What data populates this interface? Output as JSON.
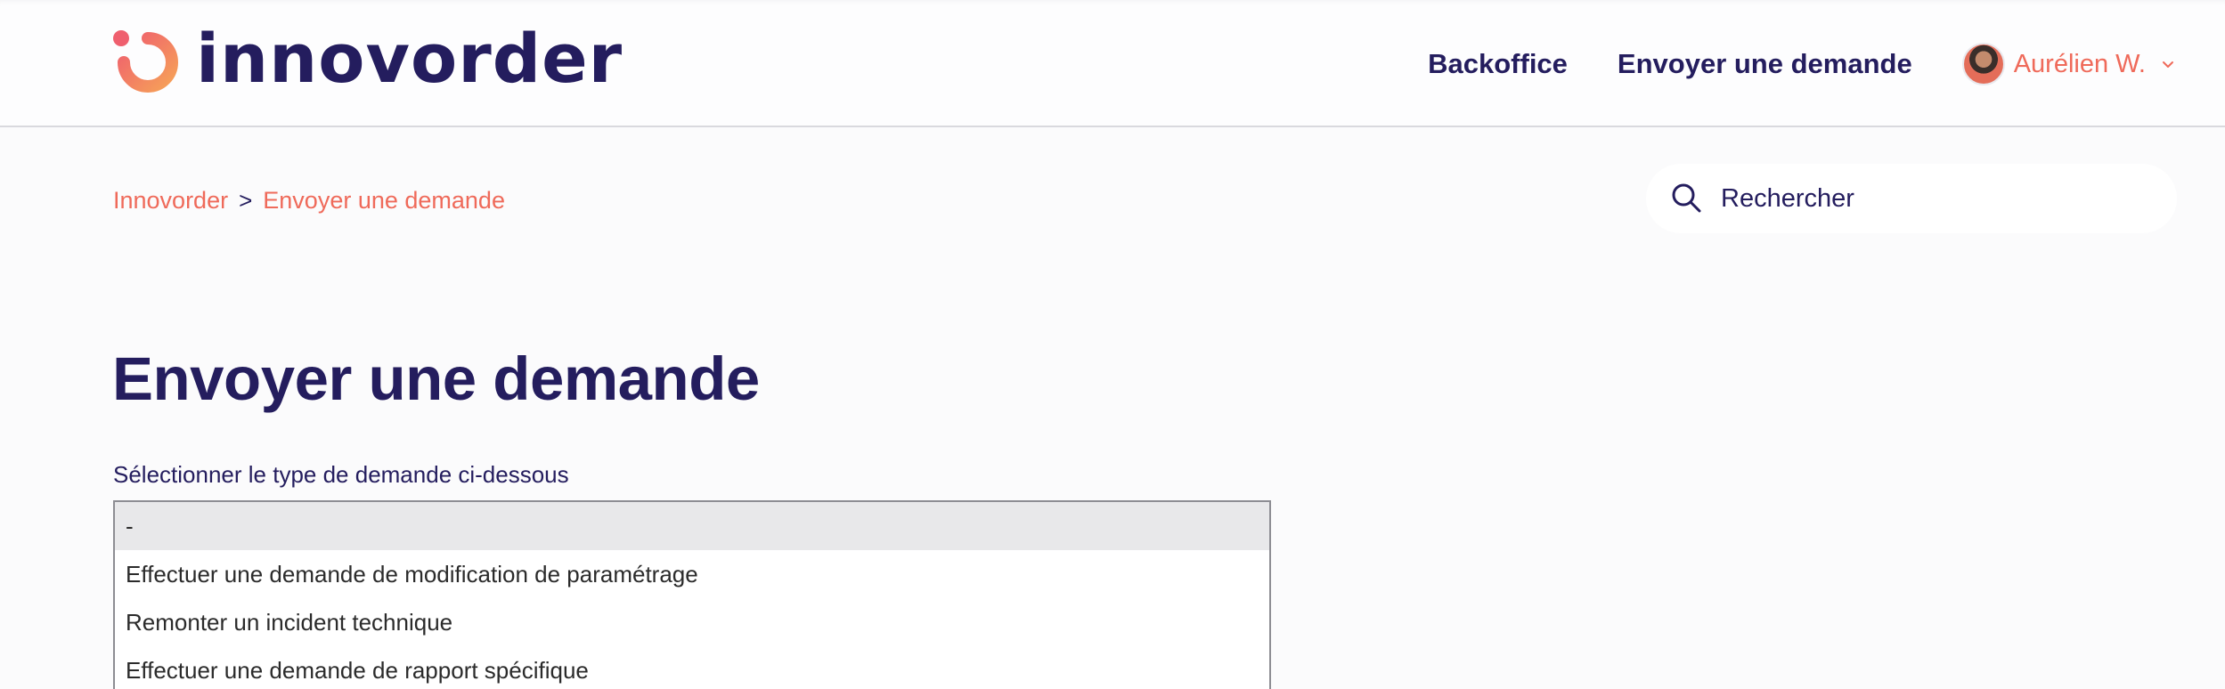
{
  "colors": {
    "primary": "#241d5e",
    "accent": "#ef6a5a",
    "logo_gradient_start": "#ef5f6e",
    "logo_gradient_end": "#f6a158",
    "background": "#fbfbfc"
  },
  "header": {
    "logo_text": "innovorder",
    "nav": [
      {
        "label": "Backoffice"
      },
      {
        "label": "Envoyer une demande"
      }
    ],
    "user": {
      "name": "Aurélien W.",
      "menu_icon": "chevron-down-icon"
    }
  },
  "breadcrumb": {
    "items": [
      "Innovorder",
      "Envoyer une demande"
    ],
    "separator": ">"
  },
  "search": {
    "placeholder": "Rechercher",
    "icon": "search-icon"
  },
  "main": {
    "title": "Envoyer une demande",
    "request_type": {
      "label": "Sélectionner le type de demande ci-dessous",
      "selected_index": 0,
      "options": [
        "-",
        "Effectuer une demande de modification de paramétrage",
        "Remonter un incident technique",
        "Effectuer une demande de rapport spécifique"
      ]
    }
  }
}
